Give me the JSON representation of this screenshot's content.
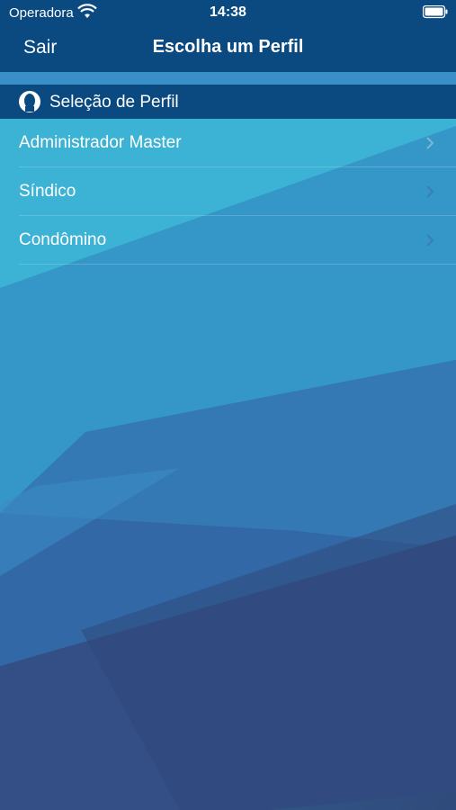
{
  "status_bar": {
    "carrier": "Operadora",
    "time": "14:38"
  },
  "nav": {
    "back_label": "Sair",
    "title": "Escolha um Perfil"
  },
  "section": {
    "title": "Seleção de Perfil",
    "icon": "user-silhouette-icon"
  },
  "profiles": [
    {
      "label": "Administrador Master"
    },
    {
      "label": "Síndico"
    },
    {
      "label": "Condômino"
    }
  ],
  "colors": {
    "bar": "#0a4a80",
    "strip": "#3a8fc9",
    "bg_light": "#3bb6d6",
    "bg_dark": "#2f4f80"
  }
}
